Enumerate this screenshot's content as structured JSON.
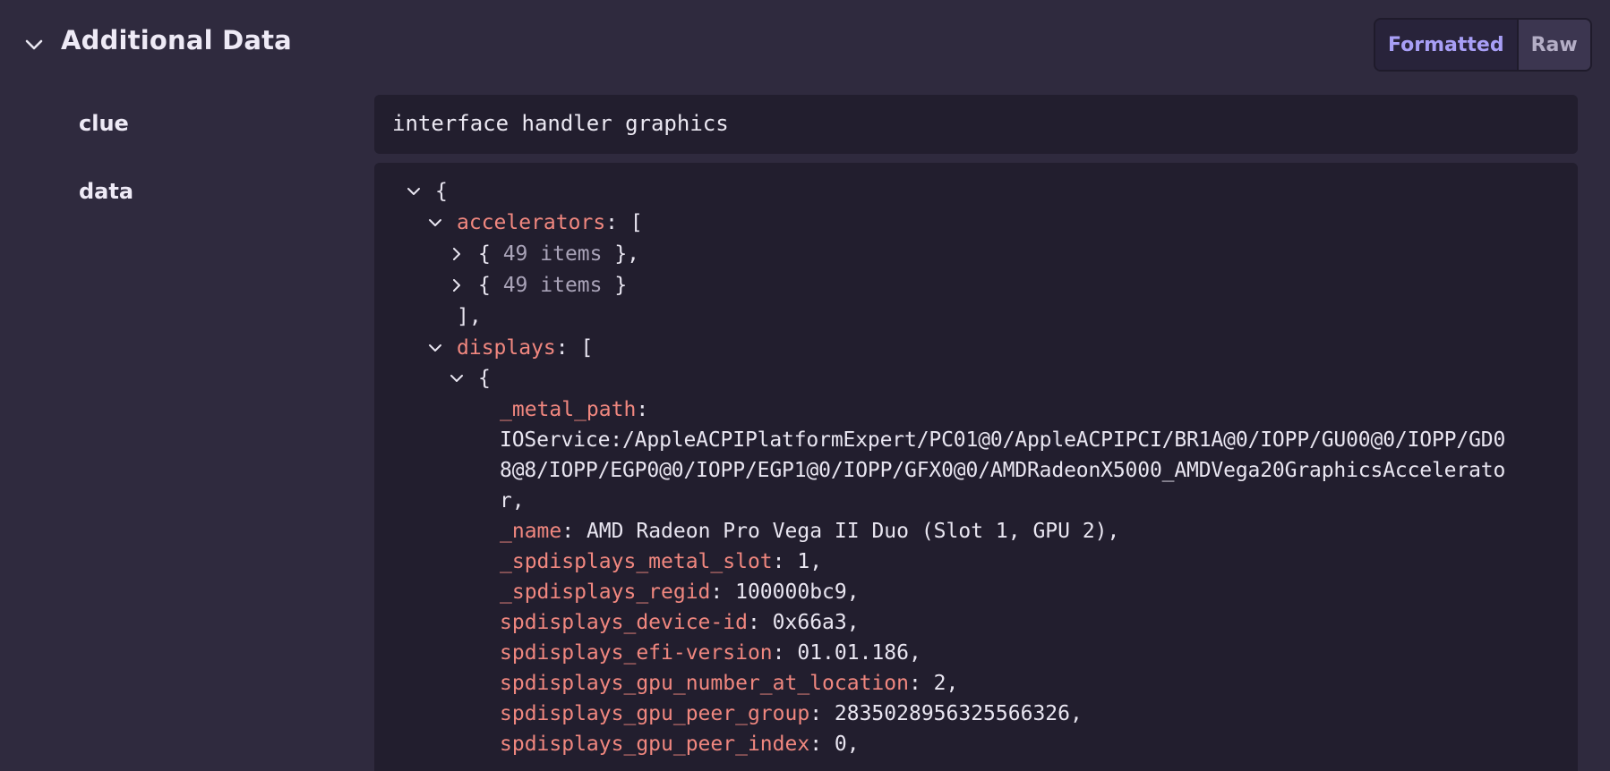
{
  "section": {
    "title": "Additional Data",
    "view_modes": {
      "formatted": "Formatted",
      "raw": "Raw",
      "active": "formatted"
    }
  },
  "clue": {
    "label": "clue",
    "value": "interface handler graphics"
  },
  "data": {
    "label": "data",
    "tree": {
      "root_open": "{",
      "accelerators_key": "accelerators",
      "accelerators_open": ": [",
      "accel_items": [
        {
          "open": "{ ",
          "summary": "49 items",
          "close": " },",
          "collapsed": true
        },
        {
          "open": "{ ",
          "summary": "49 items",
          "close": " }",
          "collapsed": true
        }
      ],
      "accelerators_close": "],",
      "displays_key": "displays",
      "displays_open": ": [",
      "display_obj_open": "{",
      "metal_path_key": "_metal_path",
      "metal_path_value_lines": [
        "IOService:/AppleACPIPlatformExpert/PC01@0/AppleACPIPCI/BR1A@0/IOPP/GU00@0/IOPP/GD0",
        "8@8/IOPP/EGP0@0/IOPP/EGP1@0/IOPP/GFX0@0/AMDRadeonX5000_AMDVega20GraphicsAccelerato",
        "r,"
      ],
      "fields": [
        {
          "key": "_name",
          "value": "AMD Radeon Pro Vega II Duo (Slot 1, GPU 2),"
        },
        {
          "key": "_spdisplays_metal_slot",
          "value": "1,"
        },
        {
          "key": "_spdisplays_regid",
          "value": "100000bc9,"
        },
        {
          "key": "spdisplays_device-id",
          "value": "0x66a3,"
        },
        {
          "key": "spdisplays_efi-version",
          "value": "01.01.186,"
        },
        {
          "key": "spdisplays_gpu_number_at_location",
          "value": "2,"
        },
        {
          "key": "spdisplays_gpu_peer_group",
          "value": "2835028956325566326,"
        },
        {
          "key": "spdisplays_gpu_peer_index",
          "value": "0,"
        }
      ]
    }
  },
  "icons": {
    "collapse": "chevron-down-icon",
    "expanded": "chevron-down-icon",
    "collapsed": "chevron-right-icon"
  },
  "colors": {
    "background": "#2f2a3e",
    "panel": "#221e2e",
    "key": "#f0877f",
    "accent": "#a89ff6"
  }
}
